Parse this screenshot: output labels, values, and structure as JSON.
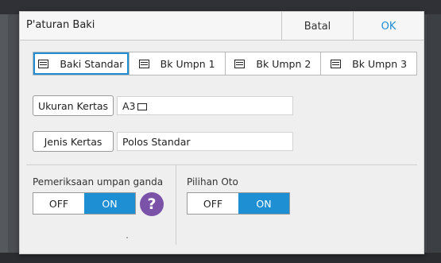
{
  "dialog": {
    "title": "P'aturan Baki",
    "cancel_label": "Batal",
    "ok_label": "OK"
  },
  "tabs": [
    {
      "label": "Baki Standar",
      "icon": "tray-icon",
      "active": true
    },
    {
      "label": "Bk Umpn 1",
      "icon": "tray-icon",
      "active": false
    },
    {
      "label": "Bk Umpn 2",
      "icon": "tray-icon",
      "active": false
    },
    {
      "label": "Bk Umpn 3",
      "icon": "tray-icon",
      "active": false
    }
  ],
  "paper_size": {
    "button_label": "Ukuran Kertas",
    "value": "A3",
    "orientation_icon": "landscape-paper-icon"
  },
  "paper_type": {
    "button_label": "Jenis Kertas",
    "value": "Polos Standar"
  },
  "double_feed": {
    "label": "Pemeriksaan umpan ganda",
    "off_label": "OFF",
    "on_label": "ON",
    "selected": "ON",
    "help_label": "?"
  },
  "auto_select": {
    "label": "Pilihan Oto",
    "off_label": "OFF",
    "on_label": "ON",
    "selected": "ON"
  },
  "colors": {
    "accent": "#1f8fd4",
    "help": "#7a53a8",
    "ok_text": "#1a8fd6"
  }
}
